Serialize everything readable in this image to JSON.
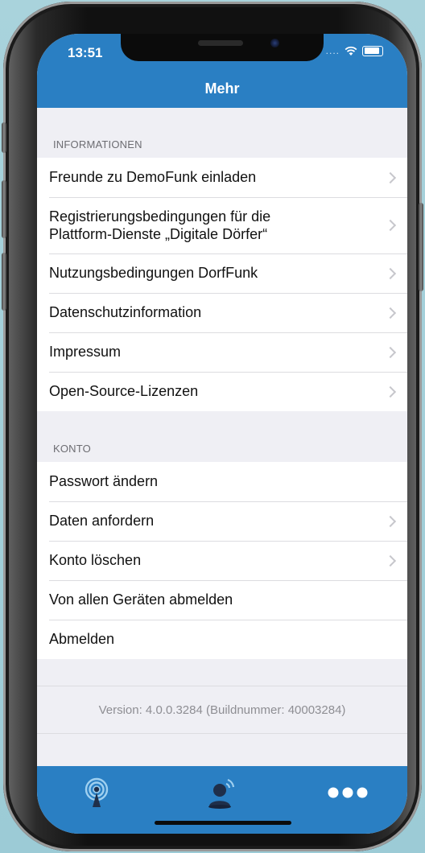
{
  "status_bar": {
    "time": "13:51",
    "signal": "...."
  },
  "nav": {
    "title": "Mehr"
  },
  "sections": [
    {
      "header": "INFORMATIONEN",
      "items": [
        {
          "label": "Freunde zu DemoFunk einladen",
          "chevron": true
        },
        {
          "label": "Registrierungsbedingungen für die\nPlattform-Dienste „Digitale Dörfer“",
          "chevron": true
        },
        {
          "label": "Nutzungsbedingungen DorfFunk",
          "chevron": true
        },
        {
          "label": "Datenschutzinformation",
          "chevron": true
        },
        {
          "label": "Impressum",
          "chevron": true
        },
        {
          "label": "Open-Source-Lizenzen",
          "chevron": true
        }
      ]
    },
    {
      "header": "KONTO",
      "items": [
        {
          "label": "Passwort ändern",
          "chevron": false
        },
        {
          "label": "Daten anfordern",
          "chevron": true
        },
        {
          "label": "Konto löschen",
          "chevron": true
        },
        {
          "label": "Von allen Geräten abmelden",
          "chevron": false
        },
        {
          "label": "Abmelden",
          "chevron": false
        }
      ]
    }
  ],
  "footer": {
    "version": "Version: 4.0.0.3284 (Buildnummer: 40003284)"
  },
  "tabbar": {
    "tabs": [
      {
        "icon": "broadcast-icon"
      },
      {
        "icon": "person-speaking-icon"
      },
      {
        "icon": "more-dots-icon"
      }
    ],
    "accent": "#2a7fc3"
  },
  "colors": {
    "header": "#2a7fc3",
    "background": "#efeff4"
  }
}
